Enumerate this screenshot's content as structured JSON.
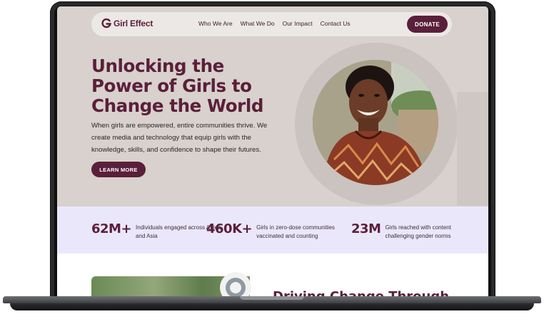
{
  "brand": {
    "name": "Girl Effect",
    "color": "#5a1f3a"
  },
  "nav": {
    "links": [
      "Who We Are",
      "What We Do",
      "Our Impact",
      "Contact Us"
    ],
    "donate_label": "DONATE"
  },
  "hero": {
    "title_lines": [
      "Unlocking the",
      "Power of Girls to",
      "Change the World"
    ],
    "body": "When girls are empowered, entire communities thrive. We create media and technology that equip girls with the knowledge, skills, and confidence to shape their futures.",
    "cta_label": "LEARN MORE"
  },
  "stats": [
    {
      "value": "62M+",
      "label": "Individuals engaged across Africa and Asia"
    },
    {
      "value": "460K+",
      "label": "Girls in zero-dose communities vaccinated and counting"
    },
    {
      "value": "23M",
      "label": "Girls reached with content challenging gender norms"
    }
  ],
  "next_section": {
    "heading": "Driving Change Through"
  },
  "colors": {
    "accent": "#5a1f3a",
    "hero_bg": "#d8d1cd",
    "stats_bg": "#ebe7fb",
    "nav_bg": "#ece8e5"
  }
}
